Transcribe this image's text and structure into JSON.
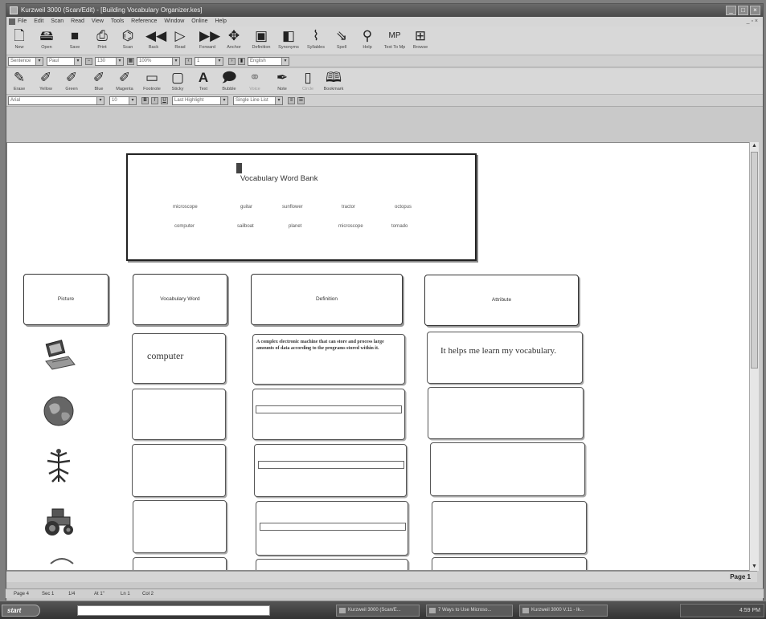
{
  "window": {
    "title": "Kurzweil 3000 (Scan/Edit) - [Building Vocabulary Organizer.kes]",
    "controls": [
      "_",
      "□",
      "×"
    ]
  },
  "menu": [
    "File",
    "Edit",
    "Scan",
    "Read",
    "View",
    "Tools",
    "Reference",
    "Window",
    "Online",
    "Help"
  ],
  "toolbar1": [
    {
      "icon": "new-icon",
      "label": "New"
    },
    {
      "icon": "open-icon",
      "label": "Open"
    },
    {
      "icon": "save-icon",
      "label": "Save"
    },
    {
      "icon": "print-icon",
      "label": "Print"
    },
    {
      "icon": "scan-icon",
      "label": "Scan"
    },
    {
      "icon": "back-icon",
      "label": "Back"
    },
    {
      "icon": "read-icon",
      "label": "Read"
    },
    {
      "icon": "forward-icon",
      "label": "Forward"
    },
    {
      "icon": "anchor-icon",
      "label": "Anchor"
    },
    {
      "icon": "definition-icon",
      "label": "Definition"
    },
    {
      "icon": "synonyms-icon",
      "label": "Synonyms"
    },
    {
      "icon": "syllables-icon",
      "label": "Syllables"
    },
    {
      "icon": "spell-icon",
      "label": "Spell"
    },
    {
      "icon": "help-icon",
      "label": "Help"
    },
    {
      "icon": "text-to-speech-icon",
      "label": "Text To Mp"
    },
    {
      "icon": "browse-icon",
      "label": "Browse"
    }
  ],
  "toolbar1_row2": {
    "reading_unit": "Sentence",
    "voice": "Paul",
    "speed": "130",
    "zoom": "100%",
    "page": "1",
    "language": "English"
  },
  "toolbar2": [
    {
      "icon": "erase-icon",
      "label": "Erase"
    },
    {
      "icon": "yellow-highlighter-icon",
      "label": "Yellow"
    },
    {
      "icon": "green-highlighter-icon",
      "label": "Green"
    },
    {
      "icon": "blue-highlighter-icon",
      "label": "Blue"
    },
    {
      "icon": "magenta-highlighter-icon",
      "label": "Magenta"
    },
    {
      "icon": "footnote-icon",
      "label": "Footnote"
    },
    {
      "icon": "sticky-note-icon",
      "label": "Sticky"
    },
    {
      "icon": "text-note-icon",
      "label": "Text"
    },
    {
      "icon": "bubble-icon",
      "label": "Bubble"
    },
    {
      "icon": "voice-note-icon",
      "label": "Voice"
    },
    {
      "icon": "pen-icon",
      "label": "Note"
    },
    {
      "icon": "circle-icon",
      "label": "Circle"
    },
    {
      "icon": "bookmark-icon",
      "label": "Bookmark"
    }
  ],
  "format_row": {
    "font": "Arial",
    "size": "10",
    "buttons": [
      "B",
      "I",
      "U"
    ],
    "highlight": "Last Highlight",
    "text_color": "Single Line List"
  },
  "word_bank": {
    "title": "Vocabulary Word Bank",
    "words_row1": [
      "microscope",
      "guitar",
      "sunflower",
      "tractor",
      "octopus"
    ],
    "words_row2": [
      "computer",
      "sailboat",
      "planet",
      "microscope",
      "tornado"
    ]
  },
  "headers": {
    "picture": "Picture",
    "vocab": "Vocabulary Word",
    "definition": "Definition",
    "attribute": "Attribute"
  },
  "rows": [
    {
      "picture": "computer-icon",
      "word": "computer",
      "definition": "A complex electronic machine that can store and process large amounts of data according to the programs stored within it.",
      "attribute": "It helps me learn my vocabulary."
    },
    {
      "picture": "globe-icon",
      "word": "",
      "definition": "",
      "attribute": ""
    },
    {
      "picture": "plant-icon",
      "word": "",
      "definition": "",
      "attribute": ""
    },
    {
      "picture": "tractor-icon",
      "word": "",
      "definition": "",
      "attribute": ""
    }
  ],
  "page_indicator": "Page 1",
  "status": {
    "page": "Page 4",
    "sec": "Sec 1",
    "pos": "1/4",
    "at": "At 1\"",
    "ln": "Ln 1",
    "col": "Col 2"
  },
  "taskbar": {
    "start": "start",
    "tasks": [
      "Kurzweil 3000 (Scan/E...",
      "7 Ways to Use Microso...",
      "Kurzweil 3000 V.11 - Ik..."
    ],
    "clock": "4:59 PM"
  }
}
